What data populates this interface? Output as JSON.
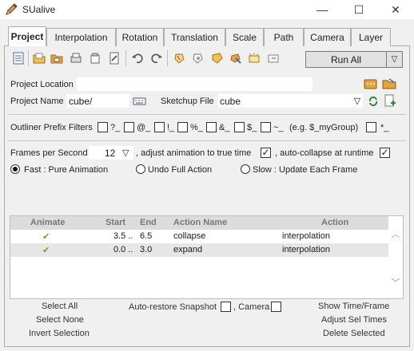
{
  "window": {
    "title": "SUalive",
    "minimize": "—",
    "maximize": "☐",
    "close": "✕"
  },
  "tabs": [
    {
      "label": "Project",
      "active": true
    },
    {
      "label": "Interpolation"
    },
    {
      "label": "Rotation"
    },
    {
      "label": "Translation"
    },
    {
      "label": "Scale"
    },
    {
      "label": "Path"
    },
    {
      "label": "Camera"
    },
    {
      "label": "Layer"
    }
  ],
  "toolbar": {
    "run_all_label": "Run All",
    "run_all_arrow": "▽"
  },
  "project": {
    "location_label": "Project Location",
    "location_value": "",
    "name_label": "Project Name",
    "name_value": "cube/",
    "sketchup_label": "Sketchup File",
    "sketchup_value": "cube",
    "sketchup_arrow": "▽"
  },
  "prefix_filters": {
    "label": "Outliner Prefix Filters",
    "items": [
      "?_",
      "@_",
      "!_",
      "%_",
      "&_",
      "$_",
      "~_"
    ],
    "example": "(e.g. $_myGroup)",
    "last_item": "*_"
  },
  "animation": {
    "fps_label": "Frames per Second",
    "fps_value": "12",
    "fps_arrow": "▽",
    "adjust_label": ", adjust animation to true time",
    "adjust_checked": true,
    "collapse_label": ", auto-collapse at runtime",
    "collapse_checked": true,
    "modes": [
      {
        "label": "Fast : Pure Animation",
        "selected": true
      },
      {
        "label": "Undo Full Action",
        "selected": false
      },
      {
        "label": "Slow : Update Each Frame",
        "selected": false
      }
    ]
  },
  "table": {
    "headers": [
      "Animate",
      "Start",
      "End",
      "Action Name",
      "Action"
    ],
    "rows": [
      {
        "animate": "✔",
        "start": "3.5 ..",
        "end": "6.5",
        "name": "collapse",
        "action": "interpolation"
      },
      {
        "animate": "✔",
        "start": "0.0 ..",
        "end": "3.0",
        "name": "expand",
        "action": "interpolation"
      }
    ],
    "scroll_up": "︿",
    "scroll_down": "﹀"
  },
  "bottom": {
    "select_all": "Select All",
    "select_none": "Select None",
    "invert_selection": "Invert Selection",
    "auto_restore": "Auto-restore Snapshot",
    "camera": ", Camera",
    "show_time": "Show Time/Frame",
    "adjust_sel": "Adjust Sel Times",
    "delete_selected": "Delete Selected"
  },
  "colors": {
    "row_alt": "#e6e6e6",
    "header_bg": "#dcdcdc",
    "accent_orange": "#e8a33c"
  }
}
